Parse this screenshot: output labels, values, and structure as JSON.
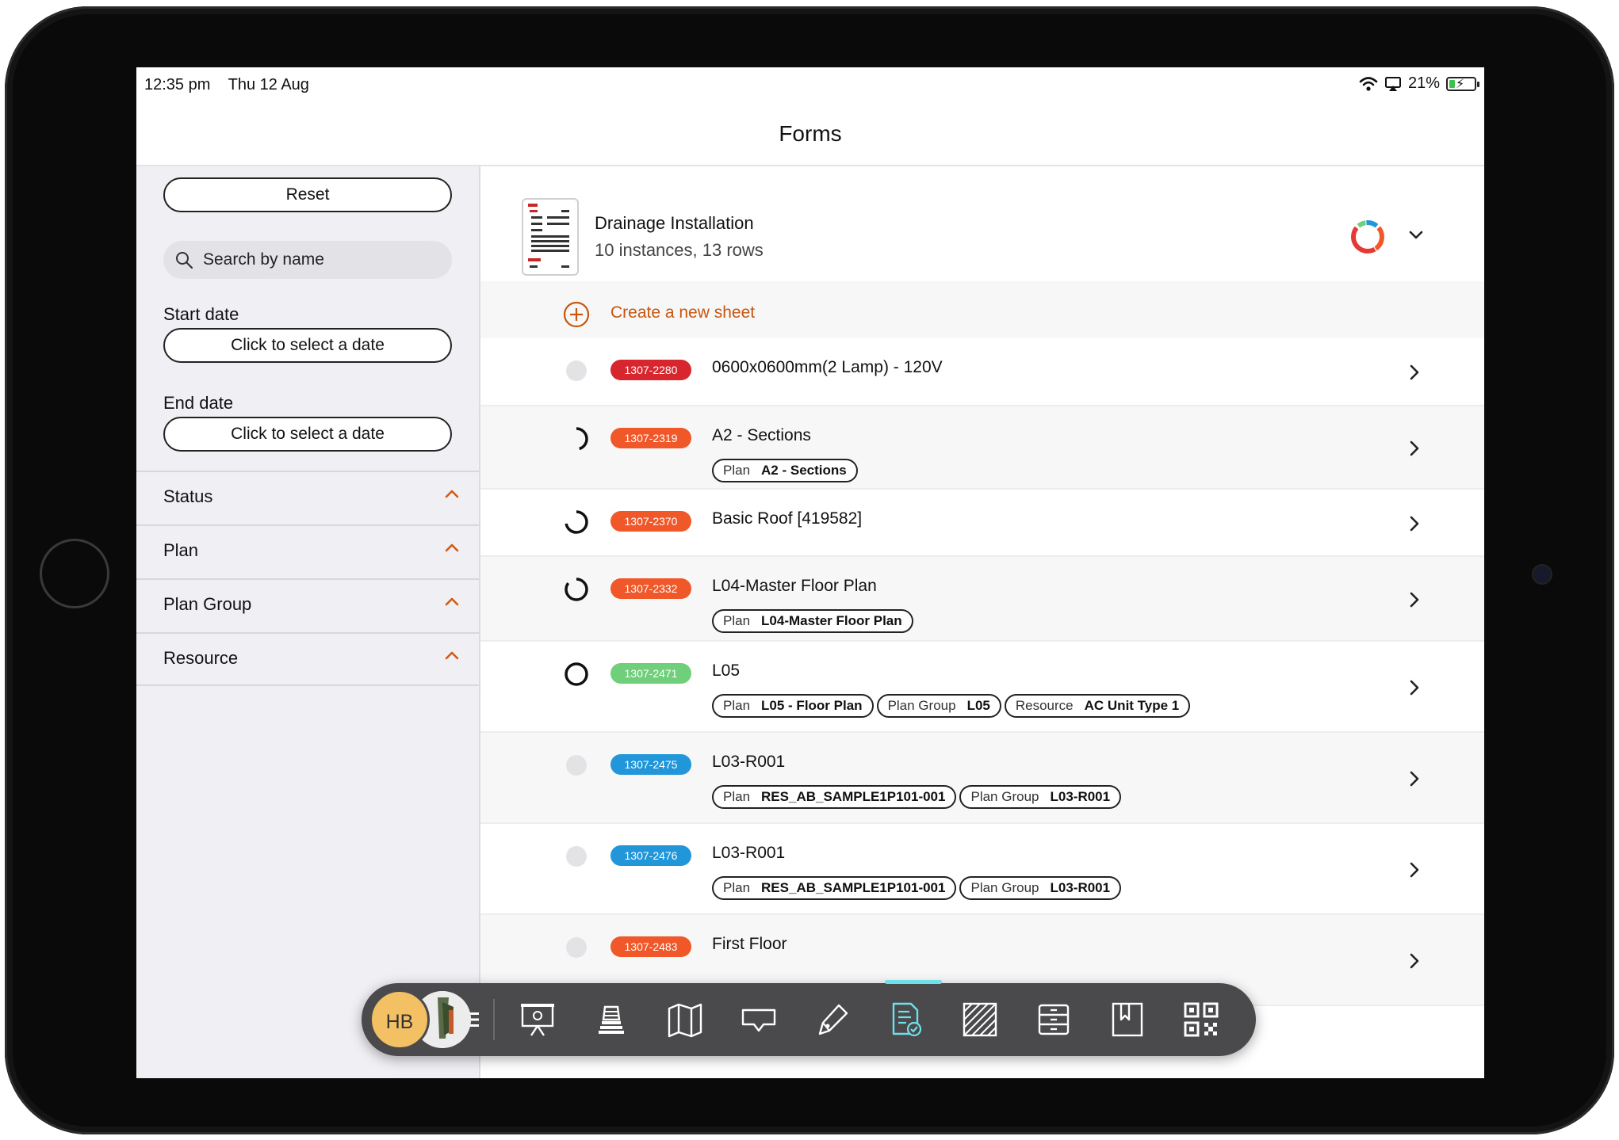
{
  "status_bar": {
    "time": "12:35 pm",
    "date": "Thu 12 Aug",
    "battery": "21%",
    "battery_level": 0.21
  },
  "page": {
    "title": "Forms"
  },
  "sidebar": {
    "reset_label": "Reset",
    "search_placeholder": "Search by name",
    "start_date": {
      "label": "Start date",
      "button": "Click to select a date"
    },
    "end_date": {
      "label": "End date",
      "button": "Click to select a date"
    },
    "filters": [
      {
        "label": "Status"
      },
      {
        "label": "Plan"
      },
      {
        "label": "Plan Group"
      },
      {
        "label": "Resource"
      }
    ]
  },
  "form": {
    "name": "Drainage Installation",
    "summary": "10 instances, 13 rows",
    "create_label": "Create a new sheet"
  },
  "rows": [
    {
      "id": "1307-2280",
      "badge_color": "#d7262e",
      "status": "empty",
      "name": "0600x0600mm(2 Lamp) - 120V",
      "tags": []
    },
    {
      "id": "1307-2319",
      "badge_color": "#f0582a",
      "status": "partial-1",
      "name": "A2 - Sections",
      "tags": [
        {
          "key": "Plan",
          "value": "A2 - Sections"
        }
      ]
    },
    {
      "id": "1307-2370",
      "badge_color": "#f0582a",
      "status": "partial-2",
      "name": "Basic Roof [419582]",
      "tags": []
    },
    {
      "id": "1307-2332",
      "badge_color": "#f0582a",
      "status": "partial-3",
      "name": "L04-Master Floor Plan",
      "tags": [
        {
          "key": "Plan",
          "value": "L04-Master Floor Plan"
        }
      ]
    },
    {
      "id": "1307-2471",
      "badge_color": "#6fcf7a",
      "status": "complete",
      "name": "L05",
      "tags": [
        {
          "key": "Plan",
          "value": "L05 - Floor Plan"
        },
        {
          "key": "Plan Group",
          "value": "L05"
        },
        {
          "key": "Resource",
          "value": "AC Unit Type 1"
        }
      ]
    },
    {
      "id": "1307-2475",
      "badge_color": "#2196d9",
      "status": "empty",
      "name": "L03-R001",
      "tags": [
        {
          "key": "Plan",
          "value": "RES_AB_SAMPLE1P101-001"
        },
        {
          "key": "Plan Group",
          "value": "L03-R001"
        }
      ]
    },
    {
      "id": "1307-2476",
      "badge_color": "#2196d9",
      "status": "empty",
      "name": "L03-R001",
      "tags": [
        {
          "key": "Plan",
          "value": "RES_AB_SAMPLE1P101-001"
        },
        {
          "key": "Plan Group",
          "value": "L03-R001"
        }
      ]
    },
    {
      "id": "1307-2483",
      "badge_color": "#f0582a",
      "status": "empty",
      "name": "First Floor",
      "tags": []
    }
  ],
  "toolbar": {
    "avatar_initials": "HB",
    "items": [
      {
        "icon": "presentation-icon"
      },
      {
        "icon": "layers-icon"
      },
      {
        "icon": "map-icon"
      },
      {
        "icon": "chat-icon"
      },
      {
        "icon": "pen-icon"
      },
      {
        "icon": "forms-icon",
        "active": true
      },
      {
        "icon": "hatch-icon"
      },
      {
        "icon": "archive-icon"
      },
      {
        "icon": "bookmark-icon"
      },
      {
        "icon": "qr-code-icon"
      }
    ],
    "active_color": "#6fe0ea"
  }
}
